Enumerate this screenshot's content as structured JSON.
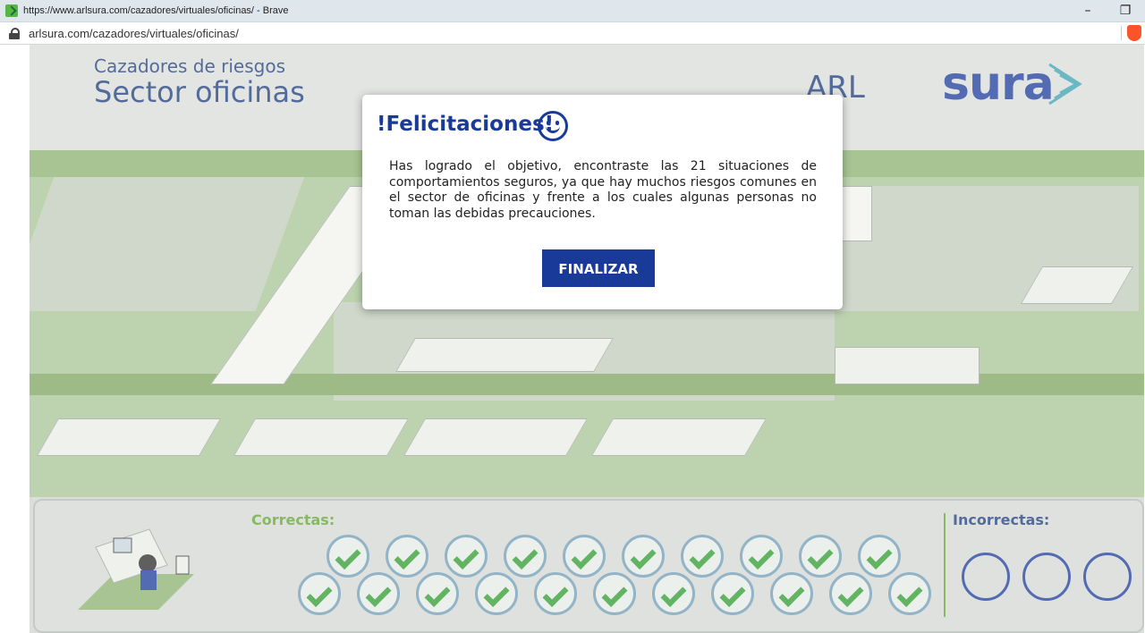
{
  "window": {
    "title": "https://www.arlsura.com/cazadores/virtuales/oficinas/ - Brave",
    "minimize_glyph": "–",
    "restore_glyph": "❐"
  },
  "address_bar": {
    "url": "arlsura.com/cazadores/virtuales/oficinas/"
  },
  "game": {
    "title_small": "Cazadores de riesgos",
    "title_big": "Sector oficinas",
    "brand_arl": "ARL",
    "brand_sura": "sura",
    "scoreboard": {
      "correct_label": "Correctas:",
      "incorrect_label": "Incorrectas:",
      "correct_count": 21,
      "incorrect_slots": 3,
      "incorrect_count": 0
    }
  },
  "modal": {
    "title": "!Felicitaciones!",
    "body": "Has logrado el objetivo, encontraste las 21 situaciones de comportamientos seguros, ya que hay muchos riesgos comunes en el sector de oficinas y frente a los cuales algunas personas no toman las debidas precauciones.",
    "button_label": "FINALIZAR"
  },
  "colors": {
    "brand_blue": "#1a3a9a",
    "correct_green": "#62a030",
    "check_green": "#2e9b2e"
  }
}
